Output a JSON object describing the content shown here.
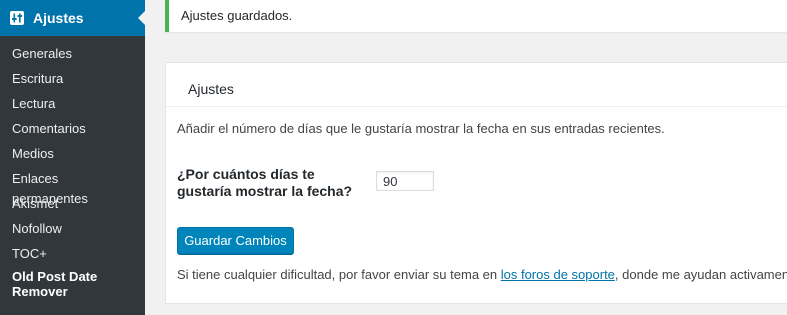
{
  "sidebar": {
    "heading": "Ajustes",
    "heading_icon": "settings-sliders-icon",
    "items": [
      {
        "label": "Generales"
      },
      {
        "label": "Escritura"
      },
      {
        "label": "Lectura"
      },
      {
        "label": "Comentarios"
      },
      {
        "label": "Medios"
      },
      {
        "label": "Enlaces permanentes"
      },
      {
        "label": "Akismet"
      },
      {
        "label": "Nofollow"
      },
      {
        "label": "TOC+"
      }
    ],
    "current_item_line1": "Old Post Date",
    "current_item_line2": "Remover"
  },
  "notice": {
    "text": "Ajustes guardados.",
    "color": "#46b450"
  },
  "panel": {
    "title": "Ajustes",
    "description": "Añadir el número de días que le gustaría mostrar la fecha en sus entradas recientes.",
    "field_label": "¿Por cuántos días te gustaría mostrar la fecha?",
    "field_value": "90",
    "save_label": "Guardar Cambios",
    "help_before": "Si tiene cualquier dificultad, por favor enviar su tema en ",
    "help_link": "los foros de soporte",
    "help_after": ", donde me ayudan activamente."
  },
  "colors": {
    "accent": "#0073aa",
    "button": "#0085ba",
    "sidebar_bg": "#23282d",
    "submenu_bg": "#32373c"
  }
}
